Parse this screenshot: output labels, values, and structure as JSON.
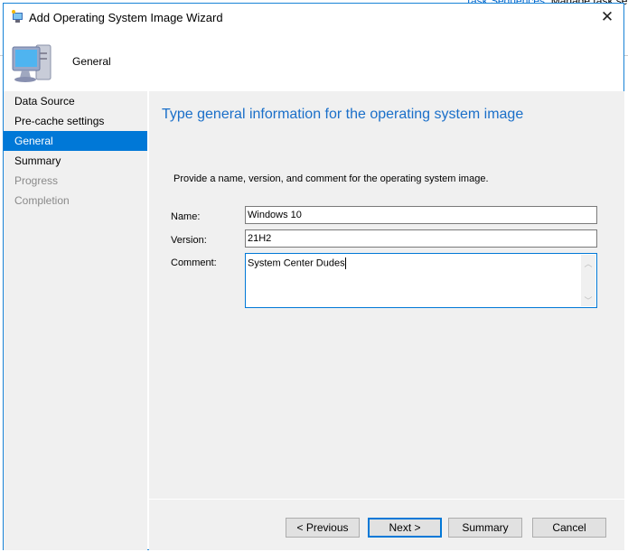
{
  "background": {
    "link": "Task Sequences:",
    "text": "Manage task se"
  },
  "window": {
    "title": "Add Operating System Image Wizard",
    "close_label": "✕"
  },
  "header": {
    "title": "General"
  },
  "nav": {
    "items": [
      {
        "label": "Data Source",
        "state": "normal"
      },
      {
        "label": "Pre-cache settings",
        "state": "normal"
      },
      {
        "label": "General",
        "state": "selected"
      },
      {
        "label": "Summary",
        "state": "normal"
      },
      {
        "label": "Progress",
        "state": "disabled"
      },
      {
        "label": "Completion",
        "state": "disabled"
      }
    ]
  },
  "main": {
    "heading": "Type general information for the operating system image",
    "description": "Provide a name, version, and comment for the operating system image.",
    "name_label": "Name:",
    "name_value": "Windows 10",
    "version_label": "Version:",
    "version_value": "21H2",
    "comment_label": "Comment:",
    "comment_value": "System Center Dudes"
  },
  "buttons": {
    "previous": "< Previous",
    "next": "Next >",
    "summary": "Summary",
    "cancel": "Cancel"
  },
  "colors": {
    "accent": "#0078d7",
    "heading": "#1a6fc9"
  }
}
